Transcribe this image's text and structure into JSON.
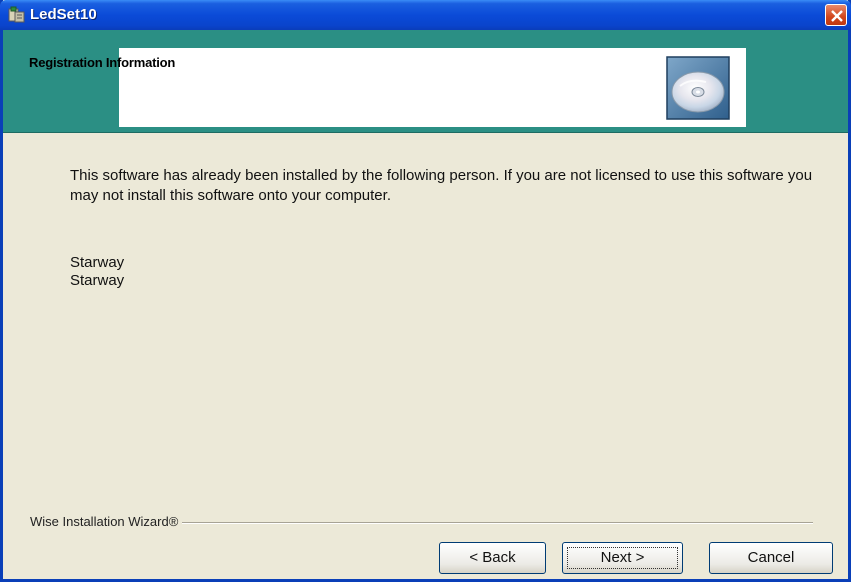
{
  "window": {
    "title": "LedSet10"
  },
  "header": {
    "title": "Registration Information",
    "icon": "cd-disc-icon"
  },
  "body": {
    "message": "This software has already been installed by the following person. If you are not licensed to use this software you may not install this software onto your computer.",
    "registered_user": {
      "name": "Starway",
      "company": "Starway"
    }
  },
  "footer": {
    "brand": "Wise Installation Wizard®",
    "buttons": {
      "back": "< Back",
      "next": "Next >",
      "cancel": "Cancel"
    }
  },
  "colors": {
    "titlebar": "#0b4bd8",
    "header_band": "#2b8f84",
    "dialog_bg": "#ece9d8"
  }
}
